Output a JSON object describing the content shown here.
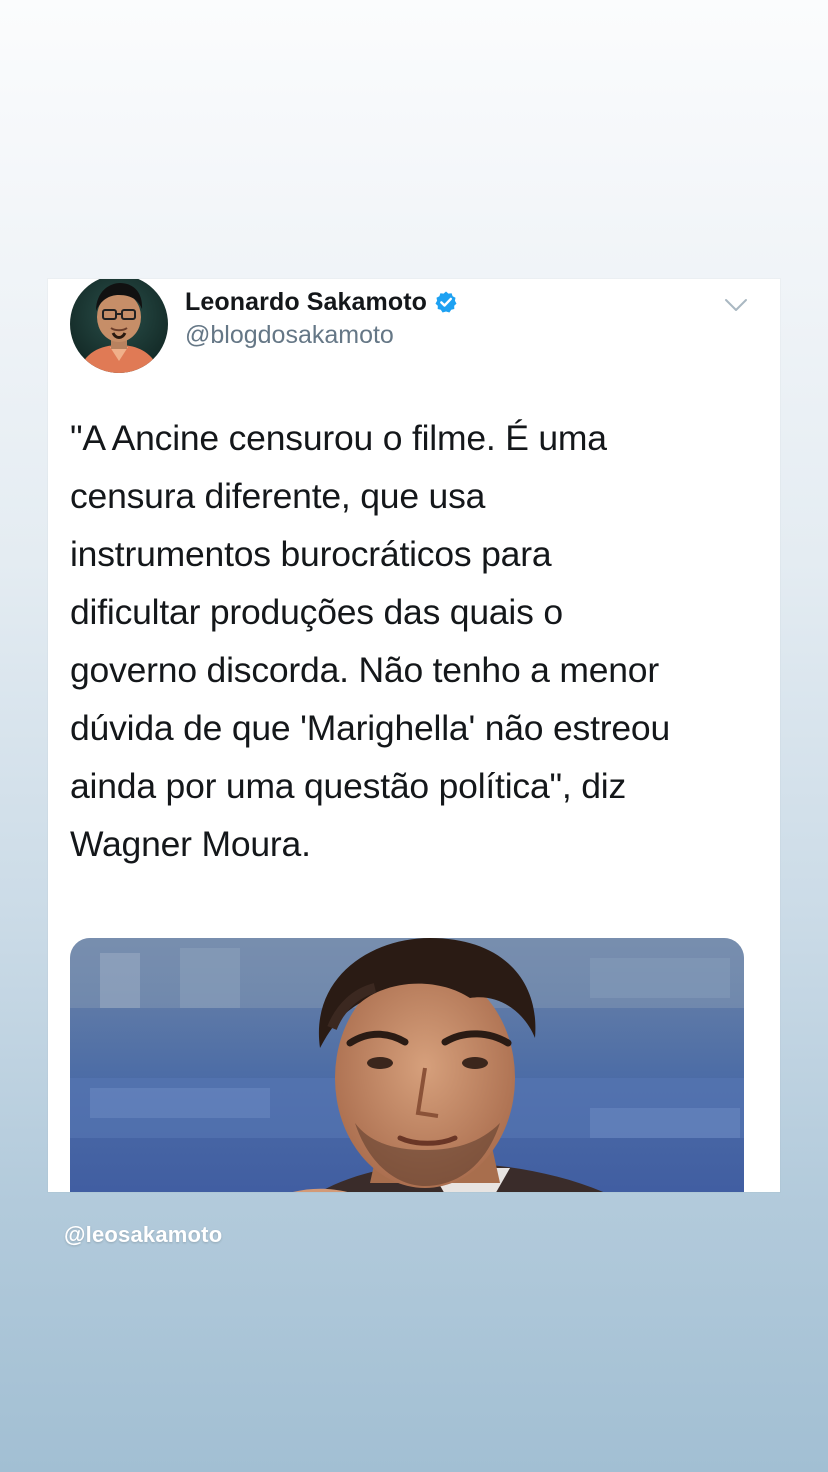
{
  "tweet": {
    "author": {
      "name": "Leonardo Sakamoto",
      "handle": "@blogdosakamoto",
      "verified": true,
      "avatar_icon": "profile-photo"
    },
    "menu_icon": "chevron-down-icon",
    "text": "\"A Ancine censurou o filme. É uma\ncensura diferente, que usa\ninstrumentos burocráticos para\ndificultar produções das quais o\ngoverno discorda. Não tenho a menor\ndúvida de que 'Marighella' não estreou\nainda por uma questão política\", diz\nWagner Moura.",
    "media_icon": "press-conference-photo"
  },
  "story": {
    "mention": "@leosakamoto"
  },
  "colors": {
    "verified_blue": "#1da1f2",
    "handle_gray": "#657786",
    "text_dark": "#14171a",
    "card_bg": "#ffffff"
  }
}
